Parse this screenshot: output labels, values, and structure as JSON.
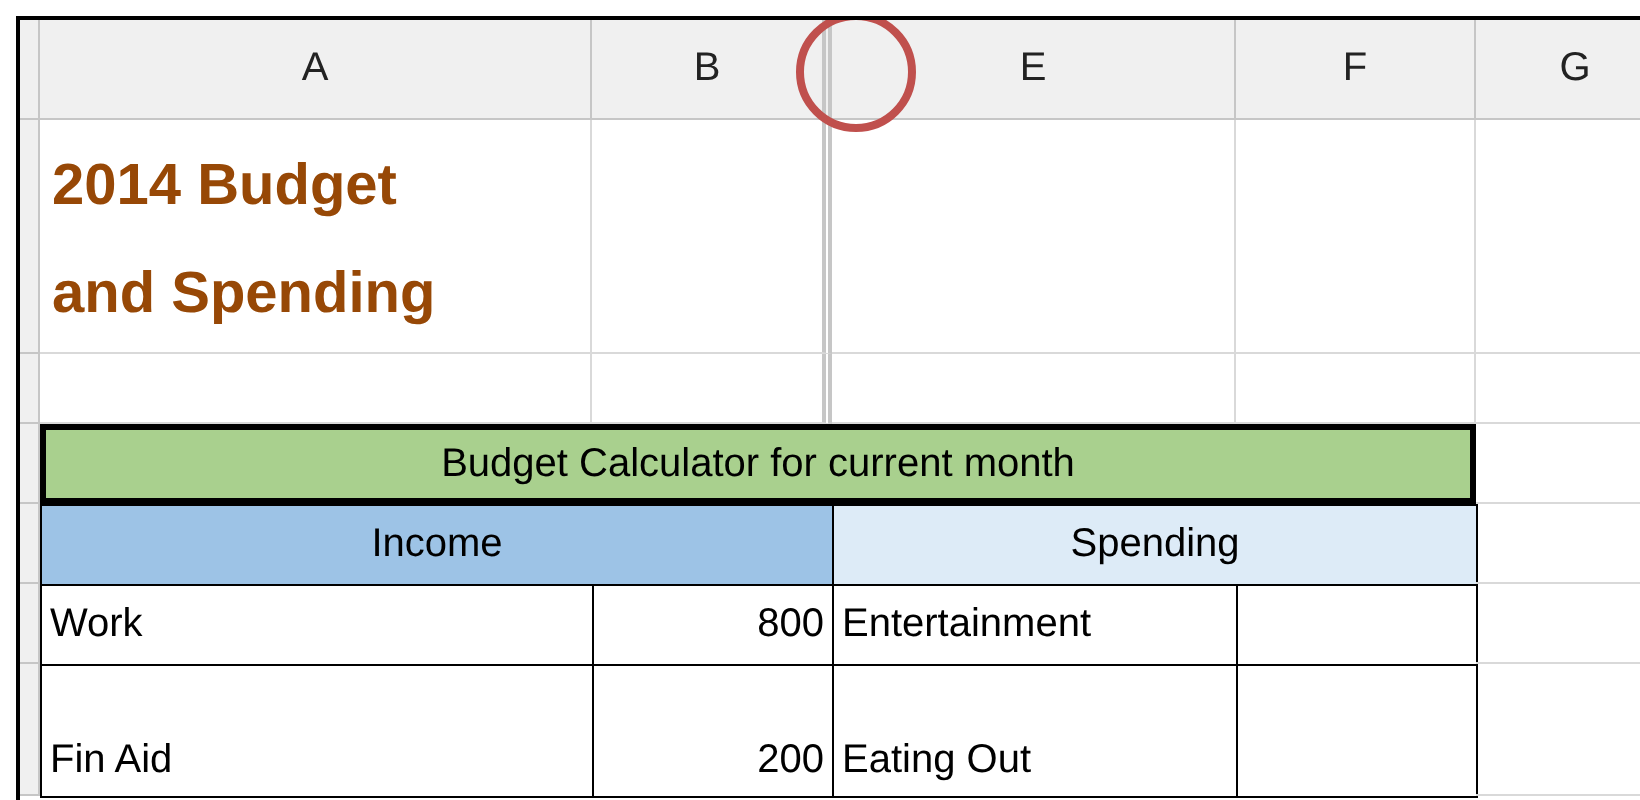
{
  "columns": [
    {
      "label": "A"
    },
    {
      "label": "B"
    },
    {
      "label": "E"
    },
    {
      "label": "F"
    },
    {
      "label": "G"
    }
  ],
  "title": "2014 Budget and Spending",
  "banner": {
    "label": "Budget Calculator for current month",
    "color": "#a9d08e"
  },
  "sections": [
    {
      "label": "Income",
      "color": "#9dc3e6"
    },
    {
      "label": "Spending",
      "color": "#ddebf7"
    }
  ],
  "rows": [
    {
      "income_item": "Work",
      "income_amount": "800",
      "spending_item": "Entertainment"
    },
    {
      "income_item": "Fin Aid",
      "income_amount": "200",
      "spending_item": "Eating Out"
    }
  ]
}
